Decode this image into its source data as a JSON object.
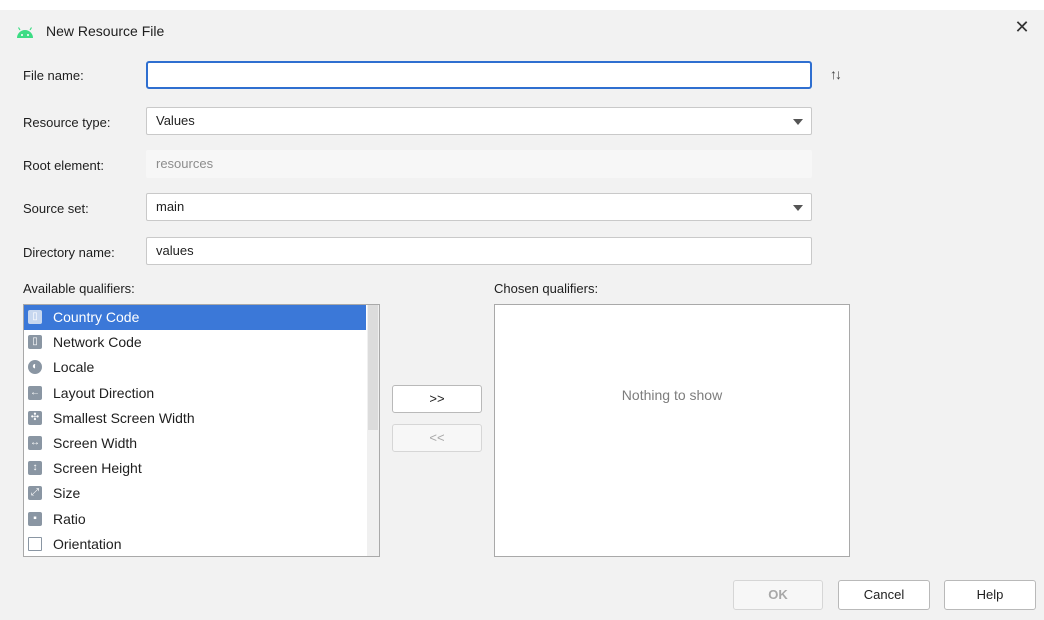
{
  "dialog": {
    "title": "New Resource File",
    "close_glyph": "✕",
    "sort_glyph": "↑↓"
  },
  "form": {
    "file_name": {
      "label": "File name:",
      "value": ""
    },
    "resource_type": {
      "label": "Resource type:",
      "value": "Values"
    },
    "root_element": {
      "label": "Root element:",
      "value": "resources"
    },
    "source_set": {
      "label": "Source set:",
      "value": "main"
    },
    "directory_name": {
      "label": "Directory name:",
      "value": "values"
    }
  },
  "qualifiers": {
    "available_label": "Available qualifiers:",
    "chosen_label": "Chosen qualifiers:",
    "chosen_empty_text": "Nothing to show",
    "available_items": [
      {
        "label": "Country Code",
        "icon": "country-code-icon",
        "selected": true
      },
      {
        "label": "Network Code",
        "icon": "network-code-icon"
      },
      {
        "label": "Locale",
        "icon": "globe-icon"
      },
      {
        "label": "Layout Direction",
        "icon": "layout-direction-icon"
      },
      {
        "label": "Smallest Screen Width",
        "icon": "smallest-width-icon"
      },
      {
        "label": "Screen Width",
        "icon": "screen-width-icon"
      },
      {
        "label": "Screen Height",
        "icon": "screen-height-icon"
      },
      {
        "label": "Size",
        "icon": "size-icon"
      },
      {
        "label": "Ratio",
        "icon": "ratio-icon"
      },
      {
        "label": "Orientation",
        "icon": "orientation-icon"
      }
    ],
    "add_button": ">>",
    "remove_button": "<<"
  },
  "buttons": {
    "ok": "OK",
    "cancel": "Cancel",
    "help": "Help"
  },
  "colors": {
    "accent": "#2f6fd0",
    "selection": "#3b78d8",
    "android_green": "#3ddc84"
  }
}
